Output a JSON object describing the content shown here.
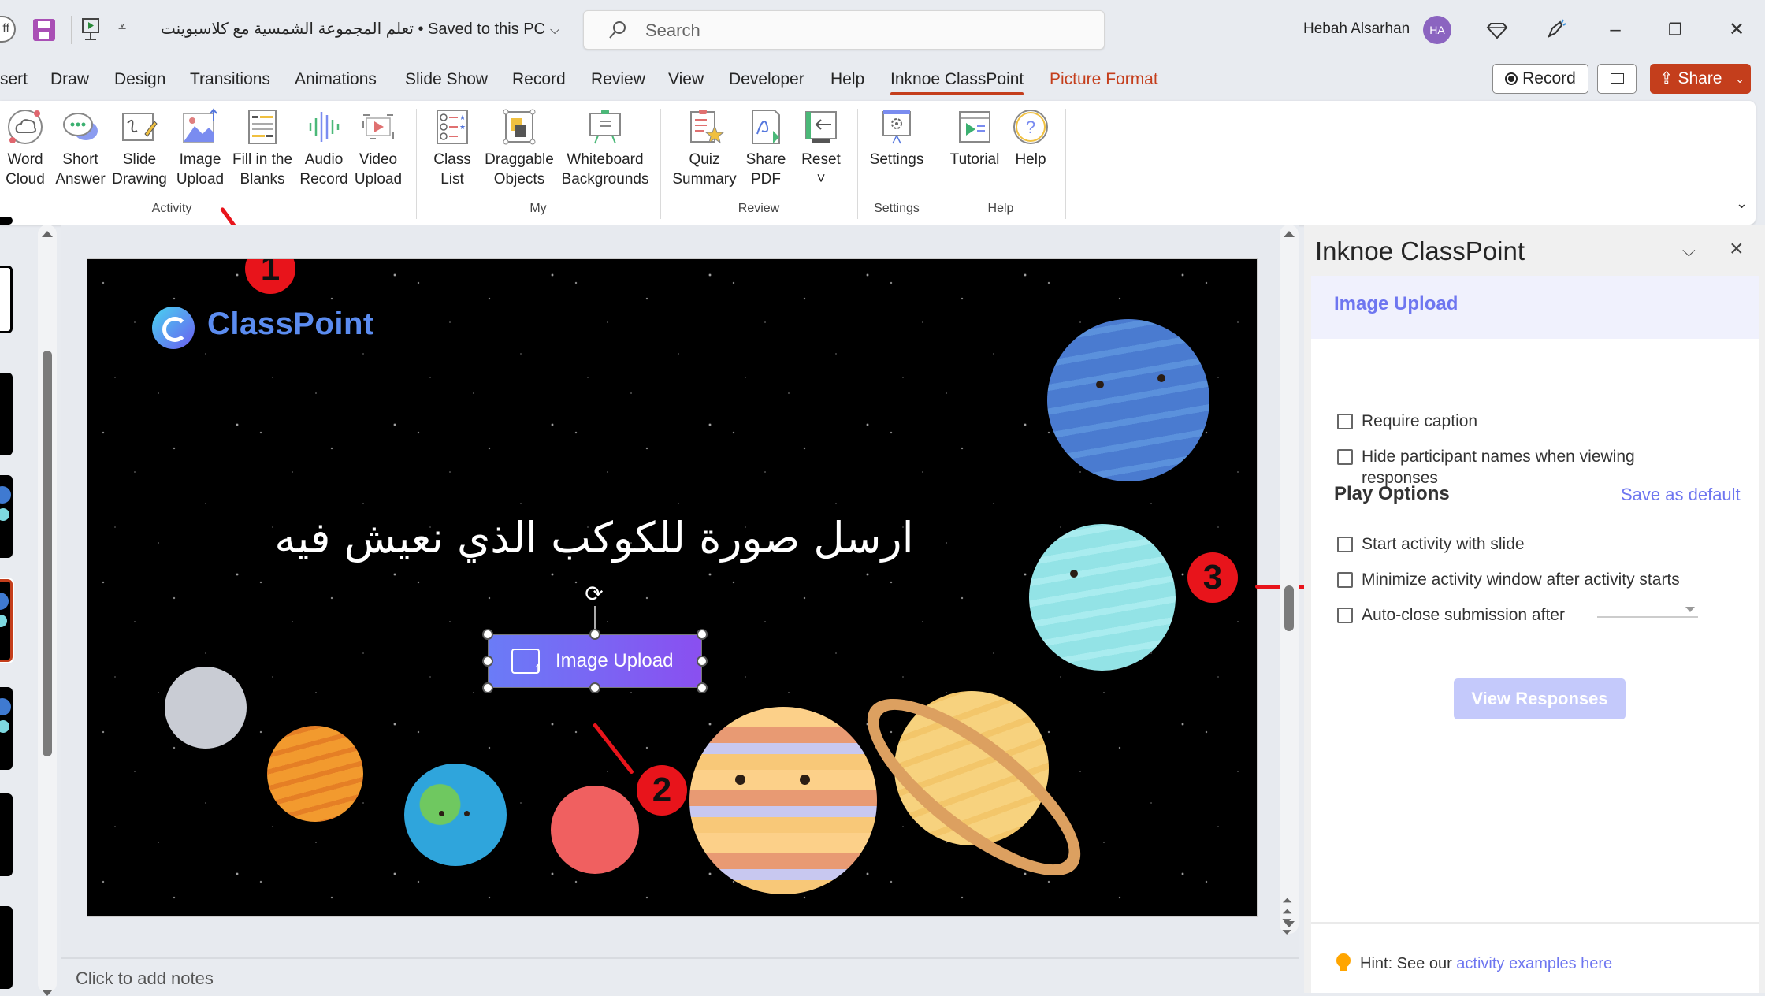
{
  "titlebar": {
    "autosave_label": "ff",
    "document_title": "تعلم المجموعة الشمسية مع كلاسبوينت • Saved to this PC",
    "search_placeholder": "Search",
    "user_name": "Hebah Alsarhan",
    "user_initials": "HA",
    "icons": [
      "save-icon",
      "present-from-start-icon",
      "qat-customize-icon",
      "diamond-icon",
      "pen-announce-icon",
      "minimize-icon",
      "restore-icon",
      "close-icon"
    ]
  },
  "tabs": [
    {
      "label": "sert"
    },
    {
      "label": "Draw"
    },
    {
      "label": "Design"
    },
    {
      "label": "Transitions"
    },
    {
      "label": "Animations"
    },
    {
      "label": "Slide Show"
    },
    {
      "label": "Record"
    },
    {
      "label": "Review"
    },
    {
      "label": "View"
    },
    {
      "label": "Developer"
    },
    {
      "label": "Help"
    },
    {
      "label": "Inknoe ClassPoint",
      "active": true
    },
    {
      "label": "Picture Format",
      "contextual": true
    }
  ],
  "tab_actions": {
    "record_label": "Record",
    "share_label": "Share"
  },
  "ribbon": {
    "groups": [
      {
        "label": "Activity",
        "buttons": [
          {
            "line1": "Word",
            "line2": "Cloud"
          },
          {
            "line1": "Short",
            "line2": "Answer"
          },
          {
            "line1": "Slide",
            "line2": "Drawing"
          },
          {
            "line1": "Image",
            "line2": "Upload"
          },
          {
            "line1": "Fill in the",
            "line2": "Blanks"
          },
          {
            "line1": "Audio",
            "line2": "Record"
          },
          {
            "line1": "Video",
            "line2": "Upload"
          }
        ]
      },
      {
        "label": "My",
        "buttons": [
          {
            "line1": "Class",
            "line2": "List"
          },
          {
            "line1": "Draggable",
            "line2": "Objects"
          },
          {
            "line1": "Whiteboard",
            "line2": "Backgrounds"
          }
        ]
      },
      {
        "label": "Review",
        "buttons": [
          {
            "line1": "Quiz",
            "line2": "Summary"
          },
          {
            "line1": "Share",
            "line2": "PDF"
          },
          {
            "line1": "Reset",
            "line2": "˅"
          }
        ]
      },
      {
        "label": "Settings",
        "buttons": [
          {
            "line1": "Settings",
            "line2": ""
          }
        ]
      },
      {
        "label": "Help",
        "buttons": [
          {
            "line1": "Tutorial",
            "line2": ""
          },
          {
            "line1": "Help",
            "line2": ""
          }
        ]
      }
    ]
  },
  "slide": {
    "logo_text": "ClassPoint",
    "title": "ارسل صورة للكوكب الذي نعيش فيه",
    "activity_button_label": "Image Upload",
    "annotations": [
      "1",
      "2",
      "3"
    ]
  },
  "notes": {
    "placeholder": "Click to add notes"
  },
  "panel": {
    "title": "Inknoe ClassPoint",
    "activity_name": "Image Upload",
    "options": [
      {
        "label": "Require caption",
        "checked": false
      },
      {
        "label": "Hide participant names when viewing responses",
        "checked": false
      }
    ],
    "play_options_heading": "Play Options",
    "save_default_label": "Save as default",
    "play_options": [
      {
        "label": "Start activity with slide",
        "checked": false
      },
      {
        "label": "Minimize activity window after activity starts",
        "checked": false
      },
      {
        "label": "Auto-close submission after",
        "checked": false
      }
    ],
    "auto_close_value": "",
    "view_responses_label": "View Responses",
    "hint_prefix": "Hint: See our ",
    "hint_link": "activity examples here"
  },
  "colors": {
    "accent": "#c43e1c",
    "classpoint_purple": "#6e76f0",
    "annotation_red": "#e8141b",
    "avatar": "#8b64c0"
  }
}
